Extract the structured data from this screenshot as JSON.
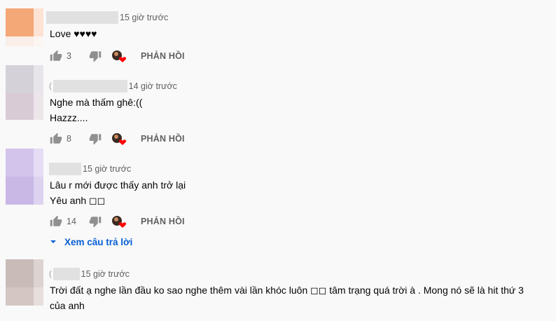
{
  "comments": [
    {
      "time": "15 giờ trước",
      "lines": [
        "Love ♥♥♥♥"
      ],
      "likes": "3",
      "reply_label": "PHẢN HỒI",
      "avatar_colors": [
        "#f4a777",
        "#fde3d3",
        "#f9eee8",
        "#fbf6f2"
      ]
    },
    {
      "time": "14 giờ trước",
      "lines": [
        "Nghe mà thấm ghê:((",
        "Hazzz...."
      ],
      "likes": "8",
      "reply_label": "PHẢN HỒI",
      "avatar_colors": [
        "#d4d1d8",
        "#e7e4ea",
        "#d9cbd6",
        "#ece6ea"
      ]
    },
    {
      "time": "15 giờ trước",
      "lines": [
        "Lâu r mới được thấy anh trở lại",
        "Yêu anh ◻◻"
      ],
      "likes": "14",
      "reply_label": "PHẢN HỒI",
      "view_replies": "Xem câu trả lời",
      "avatar_colors": [
        "#d3c4ec",
        "#e6dcf5",
        "#c9b8e6",
        "#ddd2f0"
      ]
    },
    {
      "time": "15 giờ trước",
      "lines": [
        "Trời đất ạ nghe lần đầu ko sao nghe thêm vài lần khóc luôn ◻◻ tâm trạng quá trời à . Mong nó sẽ là hit thứ 3",
        "của anh"
      ],
      "avatar_colors": [
        "#c9bcb8",
        "#ddd3d0",
        "#d4c6c2",
        "#e7dfdc"
      ]
    }
  ],
  "colors": {
    "background": "#f9f9f9",
    "secondary_text": "#606060",
    "link_blue": "#065fd4",
    "heart_red": "#ff0000"
  }
}
